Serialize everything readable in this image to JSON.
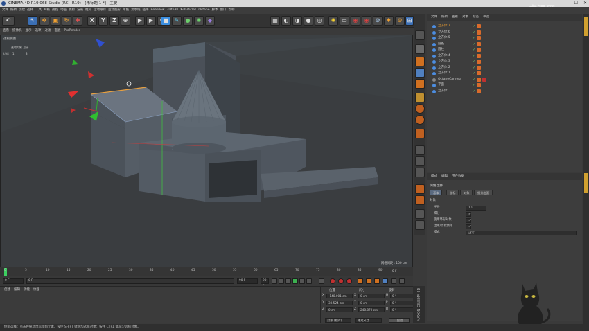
{
  "titlebar": {
    "title": "CINEMA 4D R19.068 Studio (RC - R19) - [未标题 1 *] - 主要"
  },
  "watermark": "虎课网",
  "menu": [
    "文件",
    "编辑",
    "创建",
    "选择",
    "工具",
    "网格",
    "捕捉",
    "动画",
    "模拟",
    "渲染",
    "雕刻",
    "运动跟踪",
    "运动图形",
    "角色",
    "流水线",
    "插件",
    "RealFlow",
    "3DtoAll",
    "X-Particles",
    "Octane",
    "脚本",
    "窗口",
    "帮助"
  ],
  "viewport_menu": [
    "查看",
    "摄像机",
    "显示",
    "选项",
    "过滤",
    "面板",
    "ProRender"
  ],
  "viewport": {
    "label": "透视视图",
    "info_title": "选取对象  总计",
    "info_row_label": "边缘",
    "info_v1": "1",
    "info_v2": "8",
    "grid_spacing": "网格间距 : 100 cm"
  },
  "object_manager": {
    "menu": [
      "文件",
      "编辑",
      "查看",
      "对象",
      "标签",
      "书签"
    ],
    "objects": [
      {
        "name": "立方体.7",
        "selected": true
      },
      {
        "name": "立方体.6",
        "selected": false
      },
      {
        "name": "立方体.5",
        "selected": false
      },
      {
        "name": "圆锥",
        "selected": false
      },
      {
        "name": "圆柱",
        "selected": false
      },
      {
        "name": "立方体.4",
        "selected": false
      },
      {
        "name": "立方体.3",
        "selected": false
      },
      {
        "name": "立方体.2",
        "selected": false
      },
      {
        "name": "立方体.1",
        "selected": false
      },
      {
        "name": "OctaneCamera",
        "selected": false
      },
      {
        "name": "平面",
        "selected": false
      },
      {
        "name": "立方体",
        "selected": false
      }
    ]
  },
  "attributes": {
    "menu": [
      "模式",
      "编辑",
      "用户数据"
    ],
    "heading": "倒角选择",
    "tabs": [
      "基本",
      "坐标",
      "对象",
      "细分曲面"
    ],
    "section": "对象",
    "rows": [
      {
        "label": "半径",
        "value": "10"
      },
      {
        "label": "细分",
        "value": ""
      },
      {
        "label": "使用环形对象",
        "value": ""
      },
      {
        "label": "边缘/点状倒角",
        "value": ""
      },
      {
        "label": "模式",
        "value": "正常"
      }
    ]
  },
  "timeline": {
    "ticks": [
      "0",
      "5",
      "10",
      "15",
      "20",
      "25",
      "30",
      "35",
      "40",
      "45",
      "50",
      "55",
      "60",
      "65",
      "70",
      "75",
      "80",
      "85",
      "90"
    ],
    "end_label": "0 F"
  },
  "playback": {
    "start": "0 F",
    "current": "0 F",
    "end": "90 F",
    "end2": "90 F"
  },
  "material_manager": {
    "menu": [
      "创建",
      "编辑",
      "功能",
      "纹理"
    ]
  },
  "coordinates": {
    "headers": [
      "位置",
      "尺寸",
      "旋转"
    ],
    "rows": [
      {
        "axis": "X",
        "pos": "-148.001 cm",
        "size": "0 cm",
        "rot_axis": "H",
        "rot": "0 °"
      },
      {
        "axis": "Y",
        "pos": "30.524 cm",
        "size": "0 cm",
        "rot_axis": "P",
        "rot": "0 °"
      },
      {
        "axis": "Z",
        "pos": "0 cm",
        "size": "248.870 cm",
        "rot_axis": "B",
        "rot": "0 °"
      }
    ],
    "mode1": "对象 (相对)",
    "mode2": "绝对尺寸",
    "apply": "应用"
  },
  "maxon": "MAXON CINEMA 4D",
  "statusbar": "倒角选择：点击并拖动鼠标倒角元素。按住 SHIFT 键增加选择对象；按住 CTRL 键减少选择对象。"
}
